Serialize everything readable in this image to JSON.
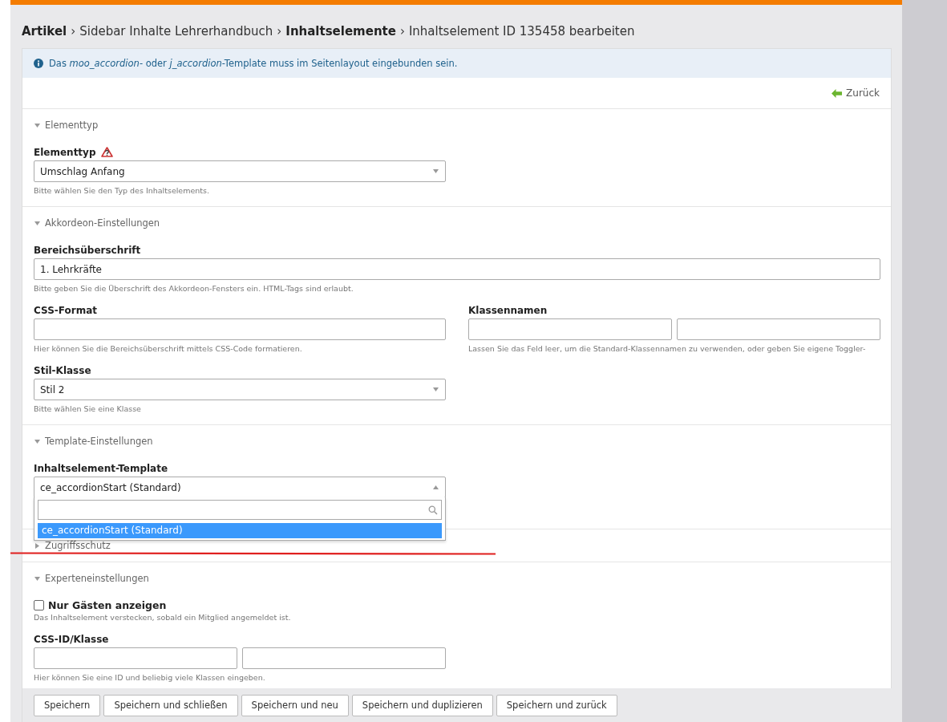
{
  "breadcrumb": [
    {
      "kind": "crumb",
      "text": "Artikel",
      "bold": true
    },
    {
      "kind": "separator",
      "text": "›"
    },
    {
      "kind": "crumb",
      "text": "Sidebar Inhalte Lehrerhandbuch",
      "bold": false
    },
    {
      "kind": "separator",
      "text": "›"
    },
    {
      "kind": "crumb",
      "text": "Inhaltselemente",
      "bold": true
    },
    {
      "kind": "separator",
      "text": "›"
    },
    {
      "kind": "crumb",
      "text": "Inhaltselement ID 135458 bearbeiten",
      "bold": false
    }
  ],
  "info": "Das *moo_accordion*- oder *j_accordion*-Template muss im Seitenlayout eingebunden sein.",
  "back_link": "Zurück",
  "sections": [
    {
      "legend": "Elementtyp",
      "expanded": true,
      "fields": [
        {
          "kind": "select",
          "label": "Elementtyp",
          "warning": true,
          "value": "Umschlag Anfang",
          "hint": "Bitte wählen Sie den Typ des Inhaltselements.",
          "wide": false
        }
      ]
    },
    {
      "legend": "Akkordeon-Einstellungen",
      "expanded": true,
      "fields": [
        {
          "kind": "text",
          "label": "Bereichsüberschrift",
          "value": "1. Lehrkräfte",
          "hint": "Bitte geben Sie die Überschrift des Akkordeon-Fensters ein. HTML-Tags sind erlaubt.",
          "wide": true
        },
        {
          "kind": "text",
          "label": "CSS-Format",
          "hint": "Hier können Sie die Bereichsüberschrift mittels CSS-Code formatieren.",
          "wide": false
        },
        {
          "kind": "multi-text",
          "label": "Klassennamen",
          "hint": "Lassen Sie das Feld leer, um die Standard-Klassennamen zu verwenden, oder geben Sie eigene Toggler-",
          "wide": false
        },
        {
          "kind": "select",
          "label": "Stil-Klasse",
          "warning": false,
          "value": "Stil 2",
          "hint": "Bitte wählen Sie eine Klasse",
          "wide": false
        }
      ]
    },
    {
      "legend": "Template-Einstellungen",
      "expanded": true,
      "fields": [
        {
          "kind": "select",
          "label": "Inhaltselement-Template",
          "warning": false,
          "value": "ce_accordionStart (Standard)",
          "wide": false,
          "open": true,
          "options": [
            {
              "text": "ce_accordionStart (Standard)",
              "selected": true
            }
          ]
        }
      ]
    },
    {
      "legend": "Zugriffsschutz",
      "expanded": false
    },
    {
      "legend": "Experteneinstellungen",
      "expanded": true,
      "fields": [
        {
          "kind": "checkbox",
          "label": "Nur Gästen anzeigen",
          "checked": false,
          "hint": "Das Inhaltselement verstecken, sobald ein Mitglied angemeldet ist.",
          "wide": true
        },
        {
          "kind": "multi-text",
          "label": "CSS-ID/Klasse",
          "hint": "Hier können Sie eine ID und beliebig viele Klassen eingeben.",
          "wide": false
        }
      ]
    }
  ],
  "buttons": [
    "Speichern",
    "Speichern und schließen",
    "Speichern und neu",
    "Speichern und duplizieren",
    "Speichern und zurück"
  ],
  "annotations": [
    {
      "kind": "line"
    }
  ]
}
